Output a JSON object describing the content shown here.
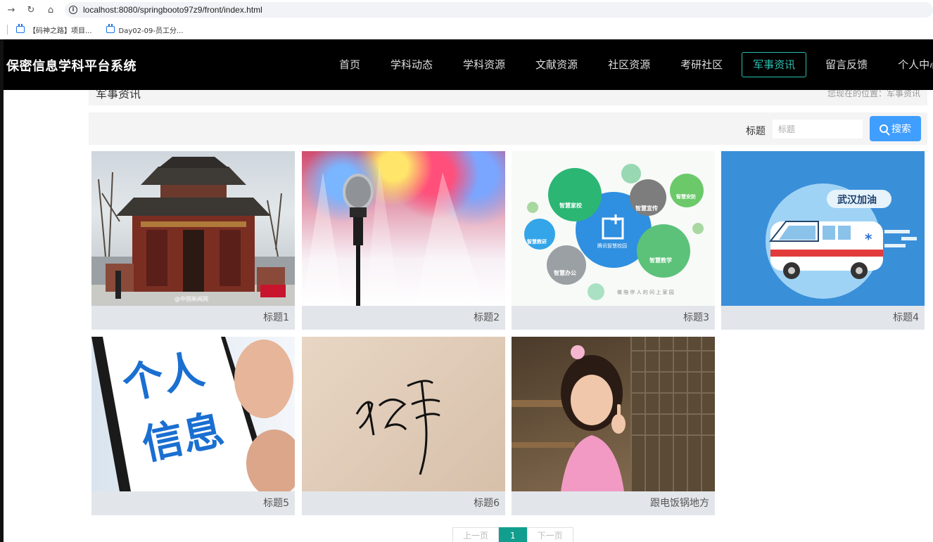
{
  "browser": {
    "url": "localhost:8080/springbooto97z9/front/index.html",
    "bookmarks": [
      "【码神之路】项目...",
      "Day02-09-员工分..."
    ]
  },
  "header": {
    "site_title": "保密信息学科平台系统",
    "menu": [
      "首页",
      "学科动态",
      "学科资源",
      "文献资源",
      "社区资源",
      "考研社区",
      "军事资讯",
      "留言反馈",
      "个人中心"
    ],
    "active_index": 6
  },
  "breadcrumb": {
    "title": "军事资讯",
    "path": "您现在的位置：军事资讯"
  },
  "search": {
    "label": "标题",
    "placeholder": "标题",
    "button": "搜索"
  },
  "cards": [
    {
      "caption": "标题1",
      "image": "temple-photo"
    },
    {
      "caption": "标题2",
      "image": "microphone-photo"
    },
    {
      "caption": "标题3",
      "image": "smart-campus-graphic"
    },
    {
      "caption": "标题4",
      "image": "ambulance-illustration"
    },
    {
      "caption": "标题5",
      "image": "personal-info-phone-photo"
    },
    {
      "caption": "标题6",
      "image": "signature-photo"
    },
    {
      "caption": "跟电饭锅地方",
      "image": "girl-photo"
    }
  ],
  "image_text": {
    "temple_watermark": "@中国新闻网",
    "wisdom_center": "腾讯智慧校园",
    "wisdom_bubbles": [
      "智慧家校",
      "智慧宣传",
      "智慧安防",
      "智慧教学",
      "智慧教研",
      "智慧办公"
    ],
    "wisdom_slogan": "做 陪 伴 人 的 问 上 家 园",
    "ambulance_banner": "武汉加油",
    "info_words": [
      "个人",
      "信息"
    ],
    "sign_text": "故事"
  },
  "pager": {
    "prev": "上一页",
    "current": "1",
    "next": "下一页"
  }
}
